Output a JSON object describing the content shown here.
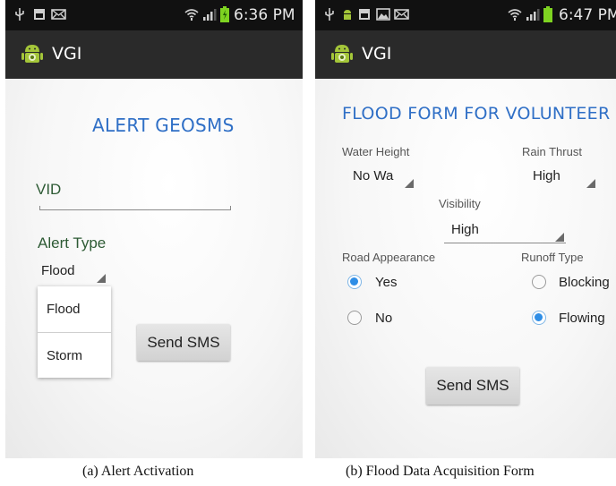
{
  "screen_a": {
    "status_time": "6:36 PM",
    "app_title": "VGI",
    "heading": "ALERT GEOSMS",
    "vid_label": "VID",
    "alert_type_label": "Alert Type",
    "alert_type_value": "Flood",
    "dropdown_options": [
      "Flood",
      "Storm"
    ],
    "send_label": "Send SMS"
  },
  "screen_b": {
    "status_time": "6:47 PM",
    "app_title": "VGI",
    "heading": "FLOOD FORM FOR VOLUNTEER",
    "water_height_label": "Water Height",
    "water_height_value": "No Wa",
    "rain_thrust_label": "Rain Thrust",
    "rain_thrust_value": "High",
    "visibility_label": "Visibility",
    "visibility_value": "High",
    "road_appearance_label": "Road Appearance",
    "road_options": [
      "Yes",
      "No"
    ],
    "road_selected": "Yes",
    "runoff_type_label": "Runoff Type",
    "runoff_options": [
      "Blocking",
      "Flowing"
    ],
    "runoff_selected": "Flowing",
    "send_label": "Send SMS"
  },
  "captions": {
    "a": "(a) Alert Activation",
    "b": "(b) Flood Data Acquisition Form"
  },
  "colors": {
    "heading_blue": "#2f6fc6",
    "radio_blue": "#2f8ee6",
    "battery_green": "#7ed321",
    "android_green": "#a4c639",
    "statusbar": "#111111",
    "actionbar": "#2a2a2a"
  }
}
